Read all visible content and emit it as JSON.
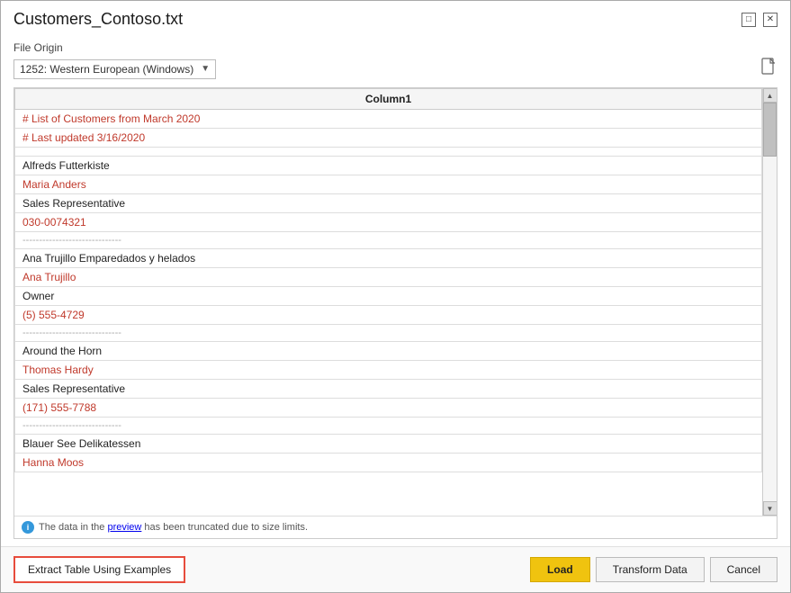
{
  "title": "Customers_Contoso.txt",
  "title_bar": {
    "minimize_label": "minimize",
    "maximize_label": "maximize",
    "close_label": "close"
  },
  "file_origin": {
    "label": "File Origin",
    "value": "1252: Western European (Windows)",
    "dropdown_arrow": "▼"
  },
  "column_header": "Column1",
  "rows": [
    {
      "text": "# List of Customers from March 2020",
      "style": "link"
    },
    {
      "text": "# Last updated 3/16/2020",
      "style": "link"
    },
    {
      "text": "",
      "style": "empty"
    },
    {
      "text": "Alfreds Futterkiste",
      "style": "normal"
    },
    {
      "text": "Maria Anders",
      "style": "link"
    },
    {
      "text": "Sales Representative",
      "style": "normal"
    },
    {
      "text": "030-0074321",
      "style": "link"
    },
    {
      "text": "------------------------------",
      "style": "separator"
    },
    {
      "text": "Ana Trujillo Emparedados y helados",
      "style": "normal"
    },
    {
      "text": "Ana Trujillo",
      "style": "link"
    },
    {
      "text": "Owner",
      "style": "normal"
    },
    {
      "text": "(5) 555-4729",
      "style": "link"
    },
    {
      "text": "------------------------------",
      "style": "separator"
    },
    {
      "text": "Around the Horn",
      "style": "normal"
    },
    {
      "text": "Thomas Hardy",
      "style": "link"
    },
    {
      "text": "Sales Representative",
      "style": "normal"
    },
    {
      "text": "(171) 555-7788",
      "style": "link"
    },
    {
      "text": "------------------------------",
      "style": "separator"
    },
    {
      "text": "Blauer See Delikatessen",
      "style": "normal"
    },
    {
      "text": "Hanna Moos",
      "style": "link"
    }
  ],
  "info": {
    "icon": "i",
    "message": "The data in the preview has been truncated due to size limits.",
    "link_text": "preview"
  },
  "footer": {
    "extract_label": "Extract Table Using Examples",
    "load_label": "Load",
    "transform_label": "Transform Data",
    "cancel_label": "Cancel"
  },
  "colors": {
    "link": "#c0392b",
    "normal": "#222222",
    "separator": "#aaaaaa",
    "load_bg": "#f0c30f",
    "extract_border": "#e74c3c"
  }
}
